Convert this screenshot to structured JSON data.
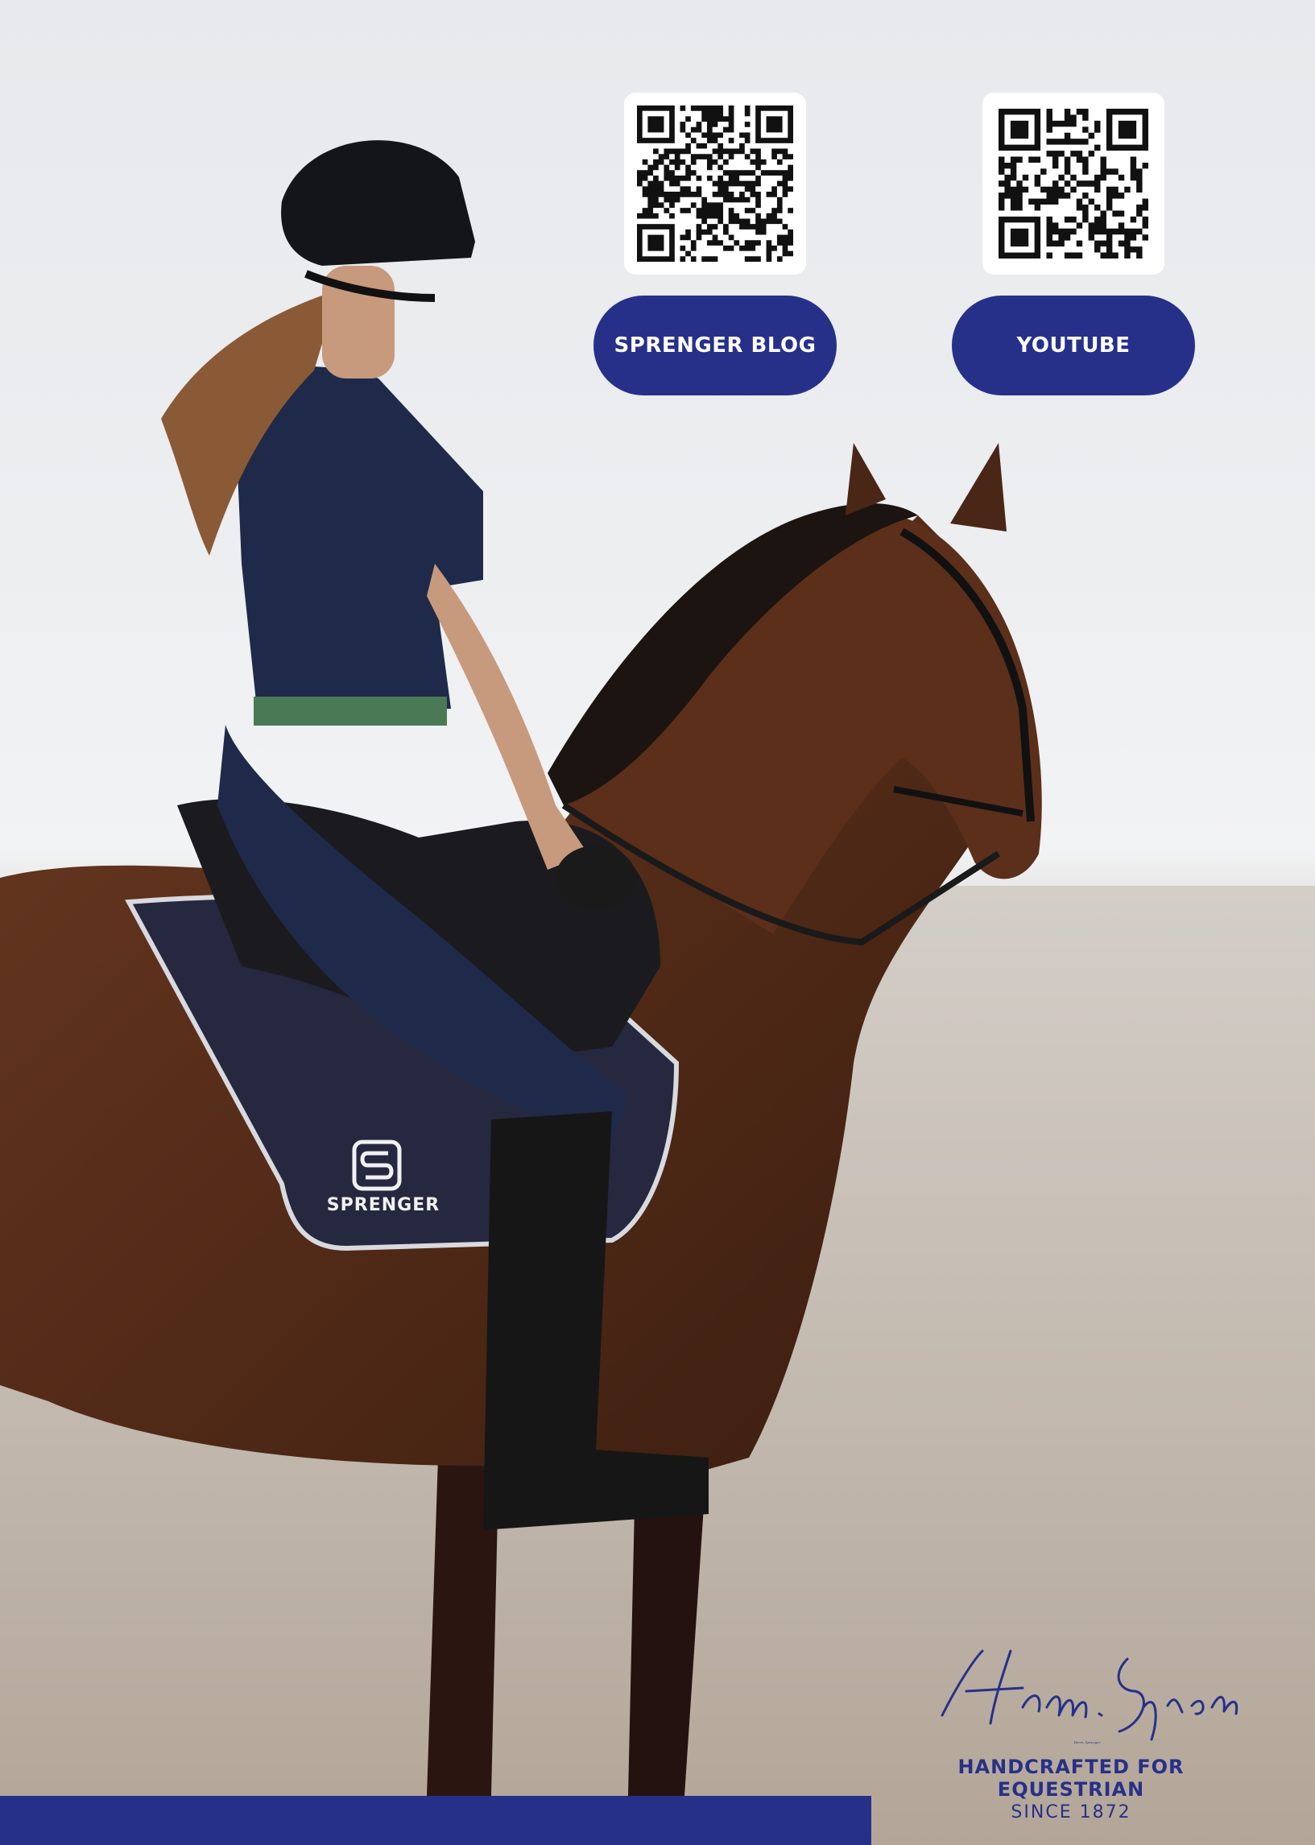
{
  "links": [
    {
      "label": "SPRENGER BLOG",
      "qr_icon": "qr-code-icon"
    },
    {
      "label": "YOUTUBE",
      "qr_icon": "qr-code-icon"
    }
  ],
  "brand": {
    "signature": "Herm. Sprenger",
    "tagline": "HANDCRAFTED FOR EQUESTRIAN",
    "since": "SINCE 1872",
    "saddle_pad_logo": "SPRENGER"
  },
  "colors": {
    "brand_blue": "#273089",
    "horse_brown": "#5a2f1c",
    "rider_navy": "#1f2a4a"
  }
}
